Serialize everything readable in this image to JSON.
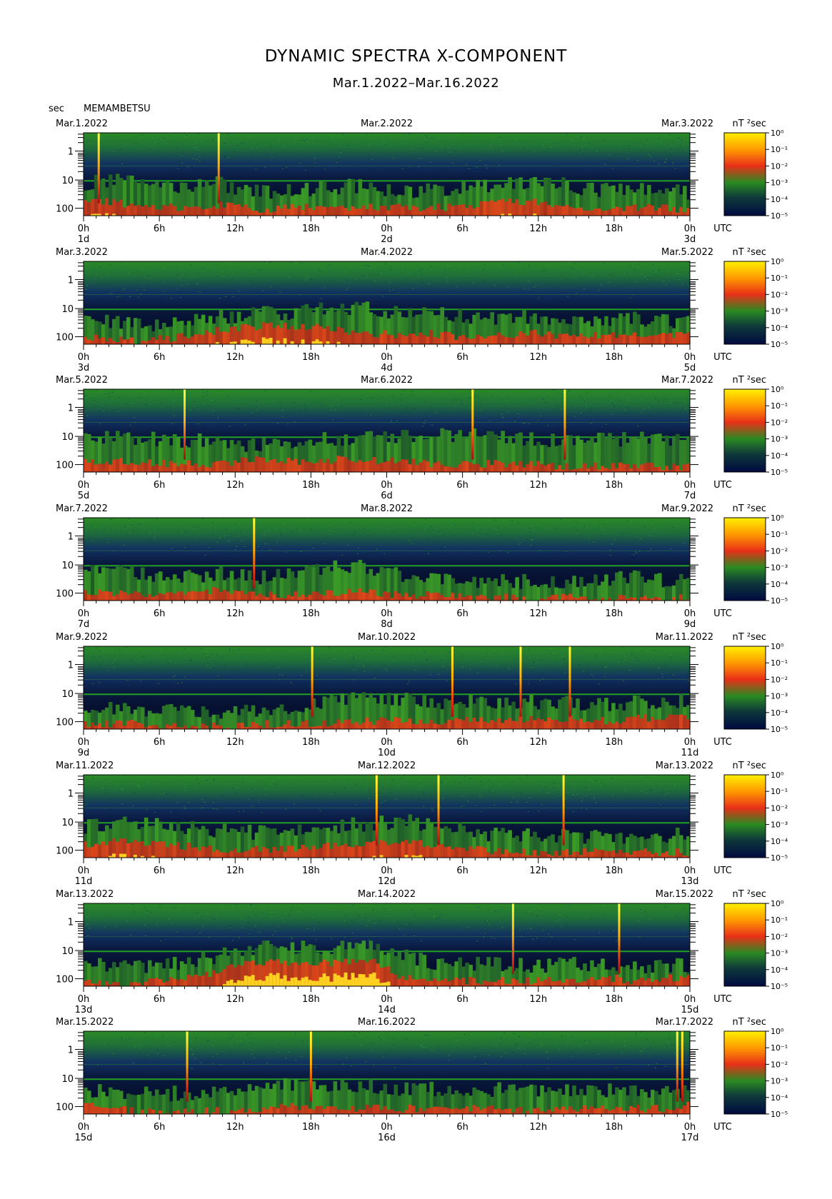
{
  "title": "DYNAMIC SPECTRA X-COMPONENT",
  "subtitle": "Mar.1.2022–Mar.16.2022",
  "unit_label": "sec",
  "station": "MEMAMBETSU",
  "colorbar_unit": "nT ²sec",
  "colorbar_ticks": [
    "10⁰",
    "10⁻¹",
    "10⁻²",
    "10⁻³",
    "10⁻⁴",
    "10⁻⁵"
  ],
  "colors": {
    "background_top": "#1f7a22",
    "background_mid": "#0a1a40",
    "low_activity": "#2e8a22",
    "high_activity": "#e8301a",
    "peak": "#ffe600",
    "line": "#22a022"
  },
  "chart_data": {
    "type": "heatmap",
    "y_axis": {
      "ticks": [
        "1",
        "10",
        "100"
      ],
      "scale": "log",
      "label": "sec"
    },
    "x_axis": {
      "ticks": [
        "0h",
        "6h",
        "12h",
        "18h",
        "0h",
        "6h",
        "12h",
        "18h",
        "0h"
      ],
      "end_label": "UTC"
    },
    "colorbar": {
      "min": "10⁻⁵",
      "max": "10⁰",
      "unit": "nT²sec"
    },
    "panels": [
      {
        "left": "Mar.1.2022",
        "center": "Mar.2.2022",
        "right": "Mar.3.2022",
        "days": [
          "1d",
          "2d",
          "3d"
        ],
        "spikes_h": [
          1.2,
          10.7
        ],
        "activity": [
          0.7,
          0.8,
          0.7,
          0.6,
          0.6,
          0.7,
          0.6,
          0.5,
          0.55,
          0.6,
          0.65,
          0.6,
          0.5,
          0.55,
          0.6,
          0.65,
          0.7,
          0.75,
          0.7,
          0.6,
          0.55,
          0.6,
          0.55,
          0.5
        ],
        "hot": [
          0.5,
          0.5,
          0.4,
          0.3,
          0.3,
          0.4,
          0.3,
          0.2,
          0.3,
          0.3,
          0.3,
          0.3,
          0.3,
          0.3,
          0.3,
          0.4,
          0.5,
          0.5,
          0.4,
          0.3,
          0.3,
          0.3,
          0.3,
          0.2
        ]
      },
      {
        "left": "Mar.3.2022",
        "center": "Mar.4.2022",
        "right": "Mar.5.2022",
        "days": [
          "3d",
          "4d",
          "5d"
        ],
        "spikes_h": [],
        "activity": [
          0.5,
          0.5,
          0.45,
          0.4,
          0.5,
          0.6,
          0.65,
          0.7,
          0.7,
          0.75,
          0.8,
          0.75,
          0.7,
          0.7,
          0.65,
          0.6,
          0.55,
          0.6,
          0.55,
          0.5,
          0.5,
          0.55,
          0.5,
          0.45
        ],
        "hot": [
          0.2,
          0.2,
          0.1,
          0.2,
          0.3,
          0.5,
          0.6,
          0.7,
          0.6,
          0.6,
          0.5,
          0.4,
          0.3,
          0.4,
          0.3,
          0.3,
          0.3,
          0.4,
          0.3,
          0.3,
          0.4,
          0.3,
          0.3,
          0.3
        ]
      },
      {
        "left": "Mar.5.2022",
        "center": "Mar.6.2022",
        "right": "Mar.7.2022",
        "days": [
          "5d",
          "6d",
          "7d"
        ],
        "spikes_h": [
          8.0,
          30.8,
          38.1
        ],
        "activity": [
          0.8,
          0.8,
          0.75,
          0.7,
          0.7,
          0.65,
          0.6,
          0.6,
          0.65,
          0.7,
          0.75,
          0.75,
          0.8,
          0.8,
          0.8,
          0.8,
          0.75,
          0.7,
          0.7,
          0.7,
          0.7,
          0.75,
          0.7,
          0.65
        ],
        "hot": [
          0.4,
          0.4,
          0.4,
          0.3,
          0.3,
          0.3,
          0.4,
          0.5,
          0.4,
          0.4,
          0.5,
          0.4,
          0.4,
          0.3,
          0.3,
          0.3,
          0.3,
          0.3,
          0.2,
          0.2,
          0.2,
          0.2,
          0.2,
          0.2
        ]
      },
      {
        "left": "Mar.7.2022",
        "center": "Mar.8.2022",
        "right": "Mar.9.2022",
        "days": [
          "7d",
          "8d",
          "9d"
        ],
        "spikes_h": [
          13.5
        ],
        "activity": [
          0.7,
          0.65,
          0.6,
          0.5,
          0.55,
          0.6,
          0.55,
          0.5,
          0.6,
          0.7,
          0.75,
          0.7,
          0.55,
          0.5,
          0.5,
          0.45,
          0.45,
          0.4,
          0.4,
          0.45,
          0.5,
          0.5,
          0.45,
          0.45
        ],
        "hot": [
          0.3,
          0.3,
          0.2,
          0.2,
          0.3,
          0.4,
          0.3,
          0.2,
          0.2,
          0.3,
          0.3,
          0.3,
          0.2,
          0.2,
          0.2,
          0.1,
          0.1,
          0.1,
          0.1,
          0.1,
          0.1,
          0.1,
          0.1,
          0.1
        ]
      },
      {
        "left": "Mar.9.2022",
        "center": "Mar.10.2022",
        "right": "Mar.11.2022",
        "days": [
          "9d",
          "10d",
          "11d"
        ],
        "spikes_h": [
          18.1,
          29.2,
          34.6,
          38.5
        ],
        "activity": [
          0.5,
          0.45,
          0.45,
          0.4,
          0.4,
          0.4,
          0.4,
          0.45,
          0.5,
          0.55,
          0.65,
          0.7,
          0.65,
          0.6,
          0.6,
          0.6,
          0.55,
          0.6,
          0.6,
          0.55,
          0.55,
          0.6,
          0.6,
          0.6
        ],
        "hot": [
          0.2,
          0.2,
          0.2,
          0.1,
          0.1,
          0.1,
          0.1,
          0.2,
          0.2,
          0.2,
          0.3,
          0.3,
          0.3,
          0.3,
          0.3,
          0.3,
          0.3,
          0.4,
          0.4,
          0.4,
          0.3,
          0.4,
          0.4,
          0.4
        ]
      },
      {
        "left": "Mar.11.2022",
        "center": "Mar.12.2022",
        "right": "Mar.13.2022",
        "days": [
          "11d",
          "12d",
          "13d"
        ],
        "spikes_h": [
          23.2,
          28.1,
          38.0
        ],
        "activity": [
          0.7,
          0.75,
          0.75,
          0.7,
          0.65,
          0.6,
          0.55,
          0.55,
          0.6,
          0.6,
          0.7,
          0.75,
          0.8,
          0.75,
          0.65,
          0.55,
          0.5,
          0.5,
          0.5,
          0.45,
          0.45,
          0.45,
          0.5,
          0.5
        ],
        "hot": [
          0.5,
          0.6,
          0.6,
          0.5,
          0.4,
          0.3,
          0.3,
          0.3,
          0.3,
          0.4,
          0.5,
          0.6,
          0.6,
          0.5,
          0.4,
          0.3,
          0.2,
          0.2,
          0.2,
          0.2,
          0.2,
          0.2,
          0.2,
          0.2
        ]
      },
      {
        "left": "Mar.13.2022",
        "center": "Mar.14.2022",
        "right": "Mar.15.2022",
        "days": [
          "13d",
          "14d",
          "15d"
        ],
        "spikes_h": [
          34.0,
          42.4
        ],
        "activity": [
          0.45,
          0.45,
          0.45,
          0.5,
          0.55,
          0.65,
          0.8,
          0.9,
          0.85,
          0.85,
          0.9,
          0.95,
          0.7,
          0.55,
          0.5,
          0.5,
          0.45,
          0.45,
          0.45,
          0.5,
          0.5,
          0.45,
          0.45,
          0.45
        ],
        "hot": [
          0.1,
          0.1,
          0.1,
          0.2,
          0.3,
          0.5,
          0.8,
          0.9,
          0.8,
          0.85,
          0.9,
          0.95,
          0.4,
          0.2,
          0.2,
          0.2,
          0.2,
          0.2,
          0.2,
          0.3,
          0.3,
          0.2,
          0.3,
          0.3
        ]
      },
      {
        "left": "Mar.15.2022",
        "center": "Mar.16.2022",
        "right": "Mar.17.2022",
        "days": [
          "15d",
          "16d",
          "17d"
        ],
        "spikes_h": [
          8.2,
          18.0,
          47.0,
          47.4
        ],
        "activity": [
          0.55,
          0.5,
          0.45,
          0.45,
          0.45,
          0.45,
          0.5,
          0.6,
          0.65,
          0.6,
          0.6,
          0.6,
          0.55,
          0.55,
          0.5,
          0.55,
          0.55,
          0.5,
          0.5,
          0.5,
          0.5,
          0.5,
          0.5,
          0.5
        ],
        "hot": [
          0.3,
          0.2,
          0.1,
          0.1,
          0.1,
          0.1,
          0.1,
          0.2,
          0.3,
          0.2,
          0.2,
          0.2,
          0.2,
          0.2,
          0.2,
          0.2,
          0.2,
          0.1,
          0.2,
          0.2,
          0.2,
          0.2,
          0.2,
          0.3
        ]
      }
    ]
  }
}
